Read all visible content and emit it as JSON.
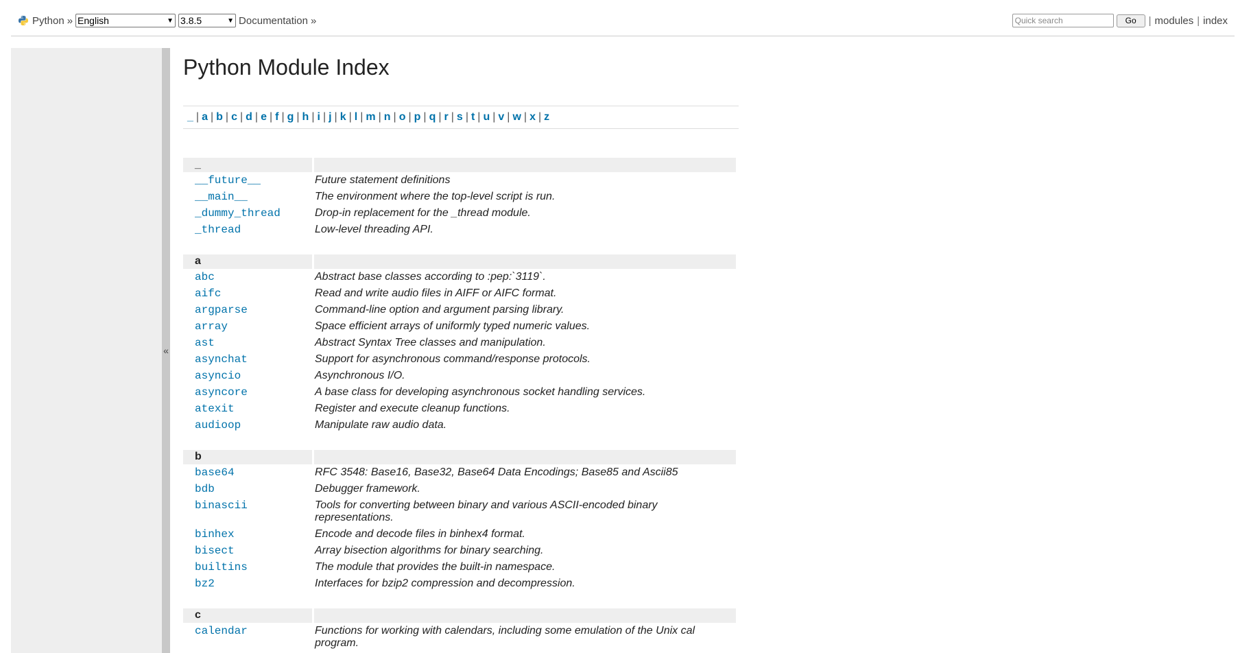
{
  "topbar": {
    "home_label": "Python",
    "sep1": "»",
    "language_selected": "English",
    "version_selected": "3.8.5",
    "docs_label": "Documentation",
    "sep2": "»",
    "search_placeholder": "Quick search",
    "go_label": "Go",
    "pipe": "|",
    "modules_label": "modules",
    "index_label": "index"
  },
  "sidebar": {
    "toggle_glyph": "«"
  },
  "page_title": "Python Module Index",
  "letters": [
    "_",
    "a",
    "b",
    "c",
    "d",
    "e",
    "f",
    "g",
    "h",
    "i",
    "j",
    "k",
    "l",
    "m",
    "n",
    "o",
    "p",
    "q",
    "r",
    "s",
    "t",
    "u",
    "v",
    "w",
    "x",
    "z"
  ],
  "sections": [
    {
      "letter": "_",
      "modules": [
        {
          "name": "__future__",
          "desc": "Future statement definitions"
        },
        {
          "name": "__main__",
          "desc": "The environment where the top-level script is run."
        },
        {
          "name": "_dummy_thread",
          "desc": "Drop-in replacement for the _thread module."
        },
        {
          "name": "_thread",
          "desc": "Low-level threading API."
        }
      ]
    },
    {
      "letter": "a",
      "modules": [
        {
          "name": "abc",
          "desc": "Abstract base classes according to :pep:`3119`."
        },
        {
          "name": "aifc",
          "desc": "Read and write audio files in AIFF or AIFC format."
        },
        {
          "name": "argparse",
          "desc": "Command-line option and argument parsing library."
        },
        {
          "name": "array",
          "desc": "Space efficient arrays of uniformly typed numeric values."
        },
        {
          "name": "ast",
          "desc": "Abstract Syntax Tree classes and manipulation."
        },
        {
          "name": "asynchat",
          "desc": "Support for asynchronous command/response protocols."
        },
        {
          "name": "asyncio",
          "desc": "Asynchronous I/O."
        },
        {
          "name": "asyncore",
          "desc": "A base class for developing asynchronous socket handling services."
        },
        {
          "name": "atexit",
          "desc": "Register and execute cleanup functions."
        },
        {
          "name": "audioop",
          "desc": "Manipulate raw audio data."
        }
      ]
    },
    {
      "letter": "b",
      "modules": [
        {
          "name": "base64",
          "desc": "RFC 3548: Base16, Base32, Base64 Data Encodings; Base85 and Ascii85"
        },
        {
          "name": "bdb",
          "desc": "Debugger framework."
        },
        {
          "name": "binascii",
          "desc": "Tools for converting between binary and various ASCII-encoded binary representations."
        },
        {
          "name": "binhex",
          "desc": "Encode and decode files in binhex4 format."
        },
        {
          "name": "bisect",
          "desc": "Array bisection algorithms for binary searching."
        },
        {
          "name": "builtins",
          "desc": "The module that provides the built-in namespace."
        },
        {
          "name": "bz2",
          "desc": "Interfaces for bzip2 compression and decompression."
        }
      ]
    },
    {
      "letter": "c",
      "modules": [
        {
          "name": "calendar",
          "desc": "Functions for working with calendars, including some emulation of the Unix cal program."
        }
      ]
    }
  ]
}
